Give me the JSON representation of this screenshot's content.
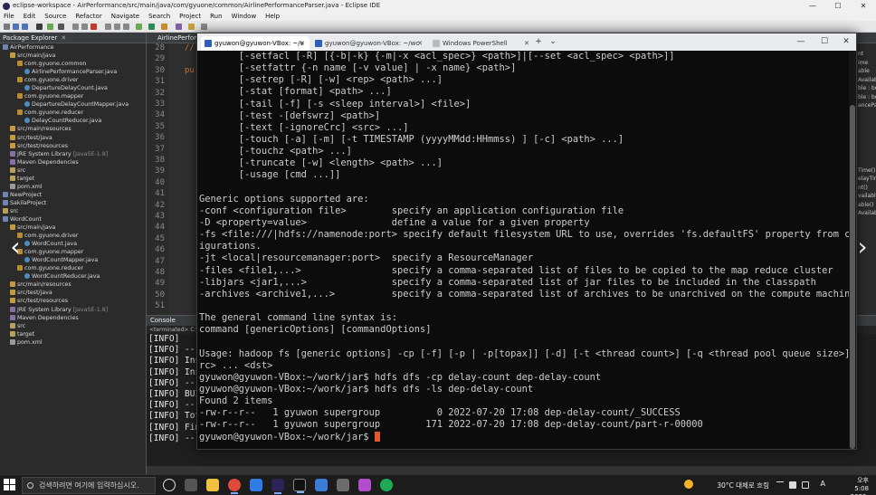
{
  "eclipse": {
    "title": "eclipse-workspace - AirPerformance/src/main/java/com/gyuone/common/AirlinePerformanceParser.java - Eclipse IDE",
    "window_controls": [
      "—",
      "☐",
      "✕"
    ],
    "menu": [
      "File",
      "Edit",
      "Source",
      "Refactor",
      "Navigate",
      "Search",
      "Project",
      "Run",
      "Window",
      "Help"
    ],
    "package_explorer": {
      "tab_label": "Package Explorer",
      "items": [
        {
          "indent": 0,
          "icon": "proj",
          "label": "AirPerformance",
          "suffix": ""
        },
        {
          "indent": 1,
          "icon": "src",
          "label": "src/main/java",
          "suffix": ""
        },
        {
          "indent": 2,
          "icon": "pkgi",
          "label": "com.gyuone.common",
          "suffix": ""
        },
        {
          "indent": 3,
          "icon": "java",
          "label": "AirlinePerformanceParser.java",
          "suffix": ""
        },
        {
          "indent": 2,
          "icon": "pkgi",
          "label": "com.gyuone.driver",
          "suffix": ""
        },
        {
          "indent": 3,
          "icon": "java",
          "label": "DepartureDelayCount.java",
          "suffix": ""
        },
        {
          "indent": 2,
          "icon": "pkgi",
          "label": "com.gyuone.mapper",
          "suffix": ""
        },
        {
          "indent": 3,
          "icon": "java",
          "label": "DepartureDelayCountMapper.java",
          "suffix": ""
        },
        {
          "indent": 2,
          "icon": "pkgi",
          "label": "com.gyuone.reducer",
          "suffix": ""
        },
        {
          "indent": 3,
          "icon": "java",
          "label": "DelayCountReducer.java",
          "suffix": ""
        },
        {
          "indent": 1,
          "icon": "src",
          "label": "src/main/resources",
          "suffix": ""
        },
        {
          "indent": 1,
          "icon": "src",
          "label": "src/test/java",
          "suffix": ""
        },
        {
          "indent": 1,
          "icon": "src",
          "label": "src/test/resources",
          "suffix": ""
        },
        {
          "indent": 1,
          "icon": "lib",
          "label": "JRE System Library",
          "suffix": " [JavaSE-1.8]"
        },
        {
          "indent": 1,
          "icon": "lib",
          "label": "Maven Dependencies",
          "suffix": ""
        },
        {
          "indent": 1,
          "icon": "fold",
          "label": "src",
          "suffix": ""
        },
        {
          "indent": 1,
          "icon": "fold",
          "label": "target",
          "suffix": ""
        },
        {
          "indent": 1,
          "icon": "file",
          "label": "pom.xml",
          "suffix": ""
        },
        {
          "indent": 0,
          "icon": "proj",
          "label": "NewProject",
          "suffix": ""
        },
        {
          "indent": 0,
          "icon": "proj",
          "label": "SakilaProject",
          "suffix": ""
        },
        {
          "indent": 0,
          "icon": "fold",
          "label": "src",
          "suffix": ""
        },
        {
          "indent": 0,
          "icon": "proj",
          "label": "WordCount",
          "suffix": ""
        },
        {
          "indent": 1,
          "icon": "src",
          "label": "src/main/java",
          "suffix": ""
        },
        {
          "indent": 2,
          "icon": "pkgi",
          "label": "com.gyuone.driver",
          "suffix": ""
        },
        {
          "indent": 3,
          "icon": "java",
          "label": "WordCount.java",
          "suffix": ""
        },
        {
          "indent": 2,
          "icon": "pkgi",
          "label": "com.gyuone.mapper",
          "suffix": ""
        },
        {
          "indent": 3,
          "icon": "java",
          "label": "WordCountMapper.java",
          "suffix": ""
        },
        {
          "indent": 2,
          "icon": "pkgi",
          "label": "com.gyuone.reducer",
          "suffix": ""
        },
        {
          "indent": 3,
          "icon": "java",
          "label": "WordCountReducer.java",
          "suffix": ""
        },
        {
          "indent": 1,
          "icon": "src",
          "label": "src/main/resources",
          "suffix": ""
        },
        {
          "indent": 1,
          "icon": "src",
          "label": "src/test/java",
          "suffix": ""
        },
        {
          "indent": 1,
          "icon": "src",
          "label": "src/test/resources",
          "suffix": ""
        },
        {
          "indent": 1,
          "icon": "lib",
          "label": "JRE System Library",
          "suffix": " [JavaSE-1.8]"
        },
        {
          "indent": 1,
          "icon": "lib",
          "label": "Maven Dependencies",
          "suffix": ""
        },
        {
          "indent": 1,
          "icon": "fold",
          "label": "src",
          "suffix": ""
        },
        {
          "indent": 1,
          "icon": "fold",
          "label": "target",
          "suffix": ""
        },
        {
          "indent": 1,
          "icon": "file",
          "label": "pom.xml",
          "suffix": ""
        }
      ]
    },
    "editor": {
      "tab_label": "AirlinePerform",
      "line_numbers": [
        "28",
        "29",
        "30",
        "31",
        "32",
        "33",
        "34",
        "35",
        "36",
        "37",
        "38",
        "39",
        "40",
        "41",
        "42",
        "43",
        "44",
        "45",
        "46",
        "47",
        "48",
        "49",
        "50",
        "51"
      ],
      "code_lines": [
        {
          "row": 0,
          "text": "//"
        },
        {
          "row": 2,
          "text": "pu"
        }
      ],
      "right_strip": [
        "nt",
        "ime",
        "able",
        "Availab",
        "ble : bo",
        "ble : bo",
        "ancePar",
        "Time()",
        "elayTime",
        "nt()",
        "vailable()",
        "able()",
        "Availab"
      ]
    },
    "console": {
      "tab_label": "Console",
      "subheader": "<terminated> C:\\",
      "lines": [
        "[INFO]",
        "[INFO] ---",
        "[INFO] Ins",
        "[INFO] Ins",
        "[INFO] ---",
        "[INFO] BUI",
        "[INFO] ---",
        "[INFO] Tot",
        "[INFO] Fin",
        "[INFO] ---"
      ]
    }
  },
  "terminal": {
    "tabs": [
      {
        "label": "gyuwon@gyuwon-VBox: ~/v",
        "active": true
      },
      {
        "label": "gyuwon@gyuwon-VBox: ~/wc",
        "active": false
      },
      {
        "label": "Windows PowerShell",
        "active": false
      }
    ],
    "new_tab": "+",
    "dropdown": "⌄",
    "window_controls": [
      "—",
      "☐",
      "✕"
    ],
    "lines": [
      "       [-setfacl [-R] [{-b|-k} {-m|-x <acl_spec>} <path>]|[--set <acl_spec> <path>]]",
      "       [-setfattr {-n name [-v value] | -x name} <path>]",
      "       [-setrep [-R] [-w] <rep> <path> ...]",
      "       [-stat [format] <path> ...]",
      "       [-tail [-f] [-s <sleep interval>] <file>]",
      "       [-test -[defswrz] <path>]",
      "       [-text [-ignoreCrc] <src> ...]",
      "       [-touch [-a] [-m] [-t TIMESTAMP (yyyyMMdd:HHmmss) ] [-c] <path> ...]",
      "       [-touchz <path> ...]",
      "       [-truncate [-w] <length> <path> ...]",
      "       [-usage [cmd ...]]",
      "",
      "Generic options supported are:",
      "-conf <configuration file>        specify an application configuration file",
      "-D <property=value>               define a value for a given property",
      "-fs <file:///|hdfs://namenode:port> specify default filesystem URL to use, overrides 'fs.defaultFS' property from conf",
      "igurations.",
      "-jt <local|resourcemanager:port>  specify a ResourceManager",
      "-files <file1,...>                specify a comma-separated list of files to be copied to the map reduce cluster",
      "-libjars <jar1,...>               specify a comma-separated list of jar files to be included in the classpath",
      "-archives <archive1,...>          specify a comma-separated list of archives to be unarchived on the compute machines",
      "",
      "The general command line syntax is:",
      "command [genericOptions] [commandOptions]",
      "",
      "Usage: hadoop fs [generic options] -cp [-f] [-p | -p[topax]] [-d] [-t <thread count>] [-q <thread pool queue size>] <s",
      "rc> ... <dst>",
      "gyuwon@gyuwon-VBox:~/work/jar$ hdfs dfs -cp delay-count dep-delay-count",
      "gyuwon@gyuwon-VBox:~/work/jar$ hdfs dfs -ls dep-delay-count",
      "Found 2 items",
      "-rw-r--r--   1 gyuwon supergroup          0 2022-07-20 17:08 dep-delay-count/_SUCCESS",
      "-rw-r--r--   1 gyuwon supergroup        171 2022-07-20 17:08 dep-delay-count/part-r-00000"
    ],
    "prompt": "gyuwon@gyuwon-VBox:~/work/jar$ "
  },
  "taskbar": {
    "search_placeholder": "검색하려면 여기에 입력하십시오.",
    "weather": "30°C 대체로 흐림",
    "ime": "A",
    "time": "오후 5:08",
    "date": "2022-07-20"
  },
  "colors": {
    "terminal_bg": "#0c0c0c",
    "terminal_text": "#cccccc",
    "cursor": "#e05a2e",
    "eclipse_bg": "#2b2b2b",
    "taskbar_bg": "#1c1c1c",
    "keyword": "#cc7832"
  }
}
